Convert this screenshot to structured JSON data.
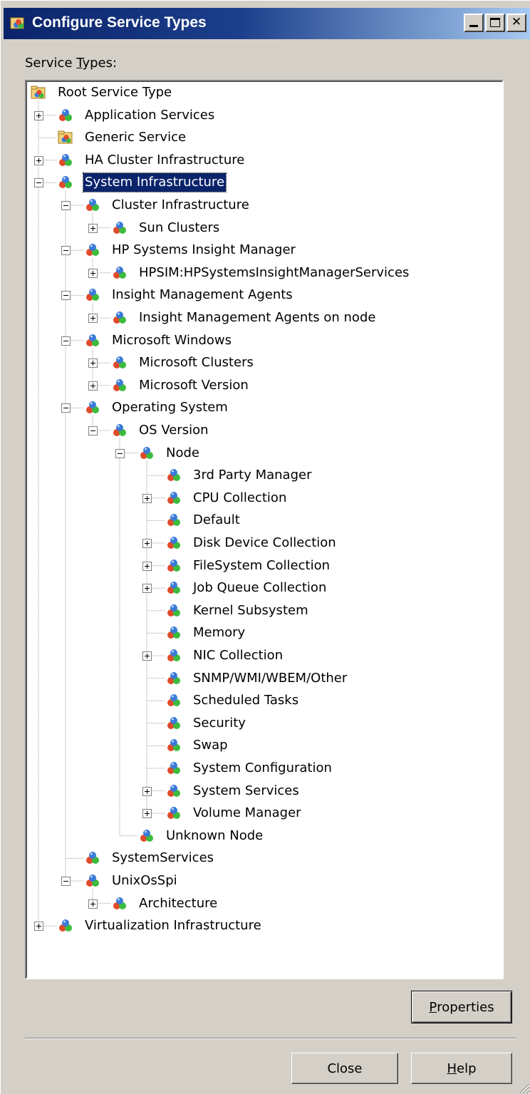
{
  "window": {
    "title": "Configure Service Types",
    "title_icon": "service-types-icon",
    "buttons": [
      "minimize",
      "maximize",
      "close"
    ]
  },
  "service_types_label_prefix": "Service ",
  "service_types_label_access": "T",
  "service_types_label_suffix": "ypes:",
  "tree": [
    {
      "label": "Root Service Type",
      "depth": 0,
      "expander": "none",
      "icon": "folder-service-icon"
    },
    {
      "label": "Application Services",
      "depth": 1,
      "expander": "plus",
      "icon": "service-icon"
    },
    {
      "label": "Generic Service",
      "depth": 1,
      "expander": "none",
      "icon": "folder-service-icon"
    },
    {
      "label": "HA Cluster Infrastructure",
      "depth": 1,
      "expander": "plus",
      "icon": "service-icon"
    },
    {
      "label": "System Infrastructure",
      "depth": 1,
      "expander": "minus",
      "icon": "service-icon",
      "selected": true
    },
    {
      "label": "Cluster Infrastructure",
      "depth": 2,
      "expander": "minus",
      "icon": "service-icon"
    },
    {
      "label": "Sun Clusters",
      "depth": 3,
      "expander": "plus",
      "icon": "service-icon"
    },
    {
      "label": "HP Systems Insight Manager",
      "depth": 2,
      "expander": "minus",
      "icon": "service-icon"
    },
    {
      "label": "HPSIM:HPSystemsInsightManagerServices",
      "depth": 3,
      "expander": "plus",
      "icon": "service-icon"
    },
    {
      "label": "Insight Management Agents",
      "depth": 2,
      "expander": "minus",
      "icon": "service-icon"
    },
    {
      "label": "Insight Management Agents on node",
      "depth": 3,
      "expander": "plus",
      "icon": "service-icon"
    },
    {
      "label": "Microsoft Windows",
      "depth": 2,
      "expander": "minus",
      "icon": "service-icon"
    },
    {
      "label": "Microsoft Clusters",
      "depth": 3,
      "expander": "plus",
      "icon": "service-icon"
    },
    {
      "label": "Microsoft Version",
      "depth": 3,
      "expander": "plus",
      "icon": "service-icon"
    },
    {
      "label": "Operating System",
      "depth": 2,
      "expander": "minus",
      "icon": "service-icon"
    },
    {
      "label": "OS Version",
      "depth": 3,
      "expander": "minus",
      "icon": "service-icon"
    },
    {
      "label": "Node",
      "depth": 4,
      "expander": "minus",
      "icon": "service-icon"
    },
    {
      "label": "3rd Party Manager",
      "depth": 5,
      "expander": "none",
      "icon": "service-icon"
    },
    {
      "label": "CPU Collection",
      "depth": 5,
      "expander": "plus",
      "icon": "service-icon"
    },
    {
      "label": "Default",
      "depth": 5,
      "expander": "none",
      "icon": "service-icon"
    },
    {
      "label": "Disk Device Collection",
      "depth": 5,
      "expander": "plus",
      "icon": "service-icon"
    },
    {
      "label": "FileSystem Collection",
      "depth": 5,
      "expander": "plus",
      "icon": "service-icon"
    },
    {
      "label": "Job Queue Collection",
      "depth": 5,
      "expander": "plus",
      "icon": "service-icon"
    },
    {
      "label": "Kernel Subsystem",
      "depth": 5,
      "expander": "none",
      "icon": "service-icon"
    },
    {
      "label": "Memory",
      "depth": 5,
      "expander": "none",
      "icon": "service-icon"
    },
    {
      "label": "NIC Collection",
      "depth": 5,
      "expander": "plus",
      "icon": "service-icon"
    },
    {
      "label": "SNMP/WMI/WBEM/Other",
      "depth": 5,
      "expander": "none",
      "icon": "service-icon"
    },
    {
      "label": "Scheduled Tasks",
      "depth": 5,
      "expander": "none",
      "icon": "service-icon"
    },
    {
      "label": "Security",
      "depth": 5,
      "expander": "none",
      "icon": "service-icon"
    },
    {
      "label": "Swap",
      "depth": 5,
      "expander": "none",
      "icon": "service-icon"
    },
    {
      "label": "System Configuration",
      "depth": 5,
      "expander": "none",
      "icon": "service-icon"
    },
    {
      "label": "System Services",
      "depth": 5,
      "expander": "plus",
      "icon": "service-icon"
    },
    {
      "label": "Volume Manager",
      "depth": 5,
      "expander": "plus",
      "icon": "service-icon"
    },
    {
      "label": "Unknown Node",
      "depth": 4,
      "expander": "none",
      "icon": "service-icon"
    },
    {
      "label": "SystemServices",
      "depth": 2,
      "expander": "none",
      "icon": "service-icon"
    },
    {
      "label": "UnixOsSpi",
      "depth": 2,
      "expander": "minus",
      "icon": "service-icon"
    },
    {
      "label": "Architecture",
      "depth": 3,
      "expander": "plus",
      "icon": "service-icon"
    },
    {
      "label": "Virtualization Infrastructure",
      "depth": 1,
      "expander": "plus",
      "icon": "service-icon"
    }
  ],
  "buttons": {
    "properties_access": "P",
    "properties_rest": "roperties",
    "close": "Close",
    "help_access": "H",
    "help_rest": "elp"
  },
  "colors": {
    "titlebar": "#0a246a",
    "selection": "#0a246a",
    "dialog_bg": "#d4d0c8"
  }
}
